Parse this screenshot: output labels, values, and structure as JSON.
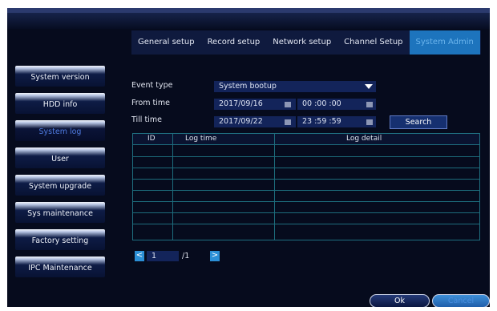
{
  "tabs": [
    {
      "label": "General setup",
      "active": false
    },
    {
      "label": "Record setup",
      "active": false
    },
    {
      "label": "Network setup",
      "active": false
    },
    {
      "label": "Channel Setup",
      "active": false
    },
    {
      "label": "System Admin",
      "active": true
    }
  ],
  "sidebar": {
    "items": [
      {
        "label": "System version"
      },
      {
        "label": "HDD info"
      },
      {
        "label": "System log",
        "active": true
      },
      {
        "label": "User"
      },
      {
        "label": "System upgrade"
      },
      {
        "label": "Sys maintenance"
      },
      {
        "label": "Factory setting"
      },
      {
        "label": "IPC Maintenance"
      }
    ]
  },
  "form": {
    "event_type_label": "Event type",
    "event_type_value": "System bootup",
    "from_time_label": "From time",
    "from_date": "2017/09/16",
    "from_clock": "00 :00 :00",
    "till_time_label": "Till time",
    "till_date": "2017/09/22",
    "till_clock": "23 :59 :59",
    "search_label": "Search"
  },
  "table": {
    "columns": [
      "ID",
      "Log time",
      "Log detail"
    ],
    "rows": []
  },
  "pager": {
    "prev_glyph": "<",
    "current_page": "1",
    "total": "/1",
    "next_glyph": ">"
  },
  "buttons": {
    "ok": "Ok",
    "cancel": "Cancel"
  },
  "colors": {
    "background": "#060b1d",
    "active_tab": "#1d74bd",
    "field": "#13245a",
    "grid": "#1d6c7c",
    "accent": "#2b8fd6"
  }
}
